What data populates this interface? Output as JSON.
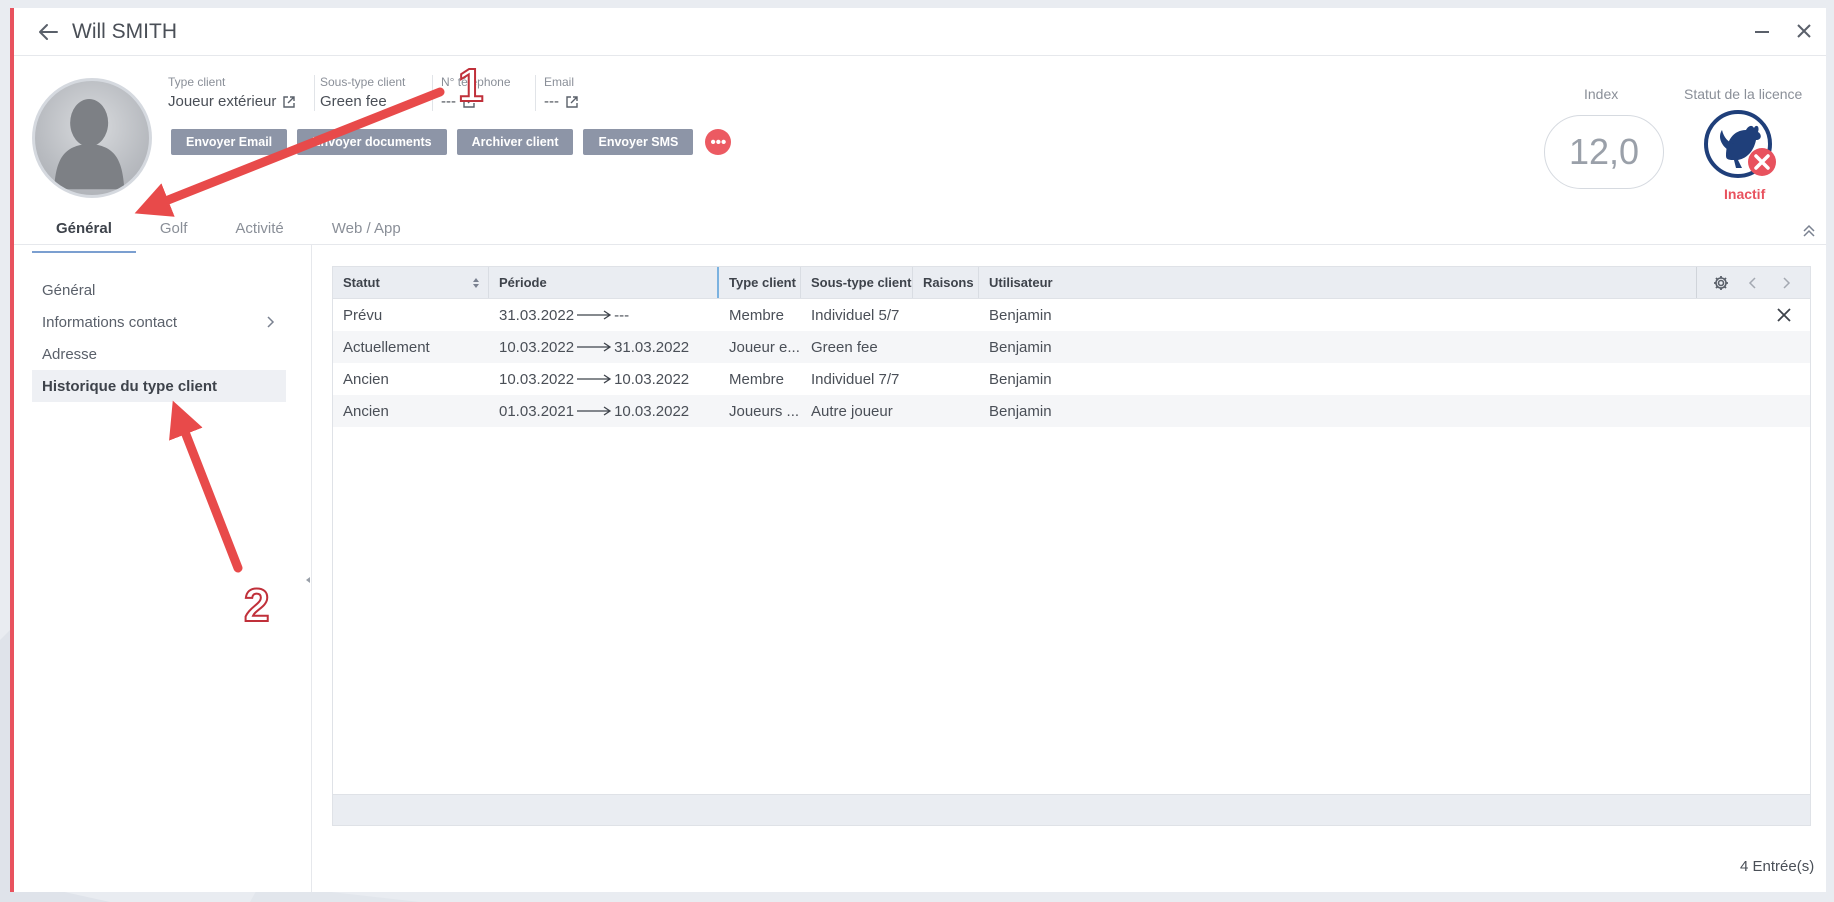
{
  "window": {
    "title": "Will SMITH"
  },
  "profile": {
    "fields": [
      {
        "label": "Type client",
        "value": "Joueur extérieur"
      },
      {
        "label": "Sous-type client",
        "value": "Green fee"
      },
      {
        "label": "N° téléphone",
        "value": "---"
      },
      {
        "label": "Email",
        "value": "---"
      }
    ],
    "actions": [
      "Envoyer Email",
      "Envoyer documents",
      "Archiver client",
      "Envoyer SMS"
    ],
    "more_label": "•••",
    "index_label": "Index",
    "index_value": "12,0",
    "licence_label": "Statut de la licence",
    "licence_status": "Inactif"
  },
  "tabs": [
    "Général",
    "Golf",
    "Activité",
    "Web / App"
  ],
  "sidenav": [
    {
      "label": "Général"
    },
    {
      "label": "Informations contact",
      "has_chevron": true
    },
    {
      "label": "Adresse"
    },
    {
      "label": "Historique du type client",
      "active": true
    }
  ],
  "grid": {
    "columns": [
      "Statut",
      "Période",
      "Type client",
      "Sous-type client",
      "Raisons",
      "Utilisateur"
    ],
    "rows": [
      {
        "statut": "Prévu",
        "from": "31.03.2022",
        "to": "---",
        "type": "Membre",
        "sous_type": "Individuel 5/7",
        "raisons": "",
        "utilisateur": "Benjamin"
      },
      {
        "statut": "Actuellement",
        "from": "10.03.2022",
        "to": "31.03.2022",
        "type": "Joueur e...",
        "sous_type": "Green fee",
        "raisons": "",
        "utilisateur": "Benjamin"
      },
      {
        "statut": "Ancien",
        "from": "10.03.2022",
        "to": "10.03.2022",
        "type": "Membre",
        "sous_type": "Individuel 7/7",
        "raisons": "",
        "utilisateur": "Benjamin"
      },
      {
        "statut": "Ancien",
        "from": "01.03.2021",
        "to": "10.03.2022",
        "type": "Joueurs ...",
        "sous_type": "Autre joueur",
        "raisons": "",
        "utilisateur": "Benjamin"
      }
    ],
    "entries": "4 Entrée(s)"
  },
  "annotations": {
    "marker_1": "1",
    "marker_2": "2"
  },
  "colors": {
    "accent_red": "#e8525e",
    "button_grey": "#8d95a7",
    "tab_underline": "#7b9fd0",
    "licence_blue": "#1f3f7a"
  }
}
